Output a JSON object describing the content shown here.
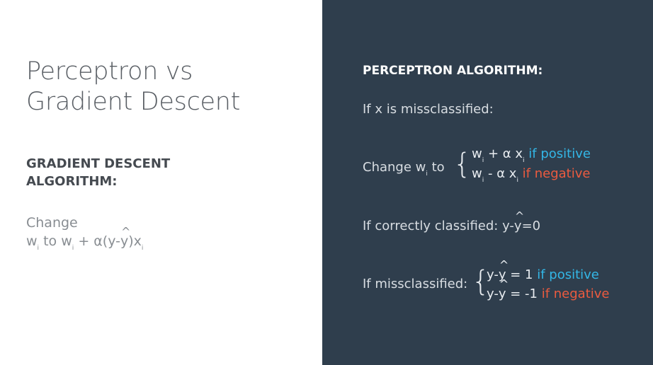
{
  "left": {
    "title_line1": "Perceptron vs",
    "title_line2": "Gradient Descent",
    "heading_line1": "GRADIENT DESCENT",
    "heading_line2": "ALGORITHM:",
    "body_line1": "Change",
    "body_w1": "w",
    "body_sub_i": "i",
    "body_to": " to ",
    "body_w2": "w",
    "body_rest1": " + α(y-",
    "body_yhat": "y",
    "body_rest2": ")x"
  },
  "right": {
    "heading": "PERCEPTRON ALGORITHM:",
    "missclassified_intro": "If x is missclassified:",
    "change_label": "Change w",
    "change_sub": "i",
    "change_to": " to",
    "case1_expr": "w",
    "case1_mid": " + α x",
    "case1_cond": " if positive",
    "case2_expr": "w",
    "case2_mid": " - α x",
    "case2_cond": " if negative",
    "correct_label": "If correctly classified: y-",
    "correct_yhat": "y",
    "correct_rest": "=0",
    "miss_label": "If missclassified:",
    "miss_case1_pre": "y-",
    "miss_case1_yhat": "y",
    "miss_case1_val": " = 1",
    "miss_case1_cond": " if positive",
    "miss_case2_pre": "y-",
    "miss_case2_yhat": "y",
    "miss_case2_val": " = -1",
    "miss_case2_cond": " if negative"
  },
  "colors": {
    "dark_panel": "#2f3e4d",
    "positive": "#33b6e6",
    "negative": "#ec5b3f"
  }
}
